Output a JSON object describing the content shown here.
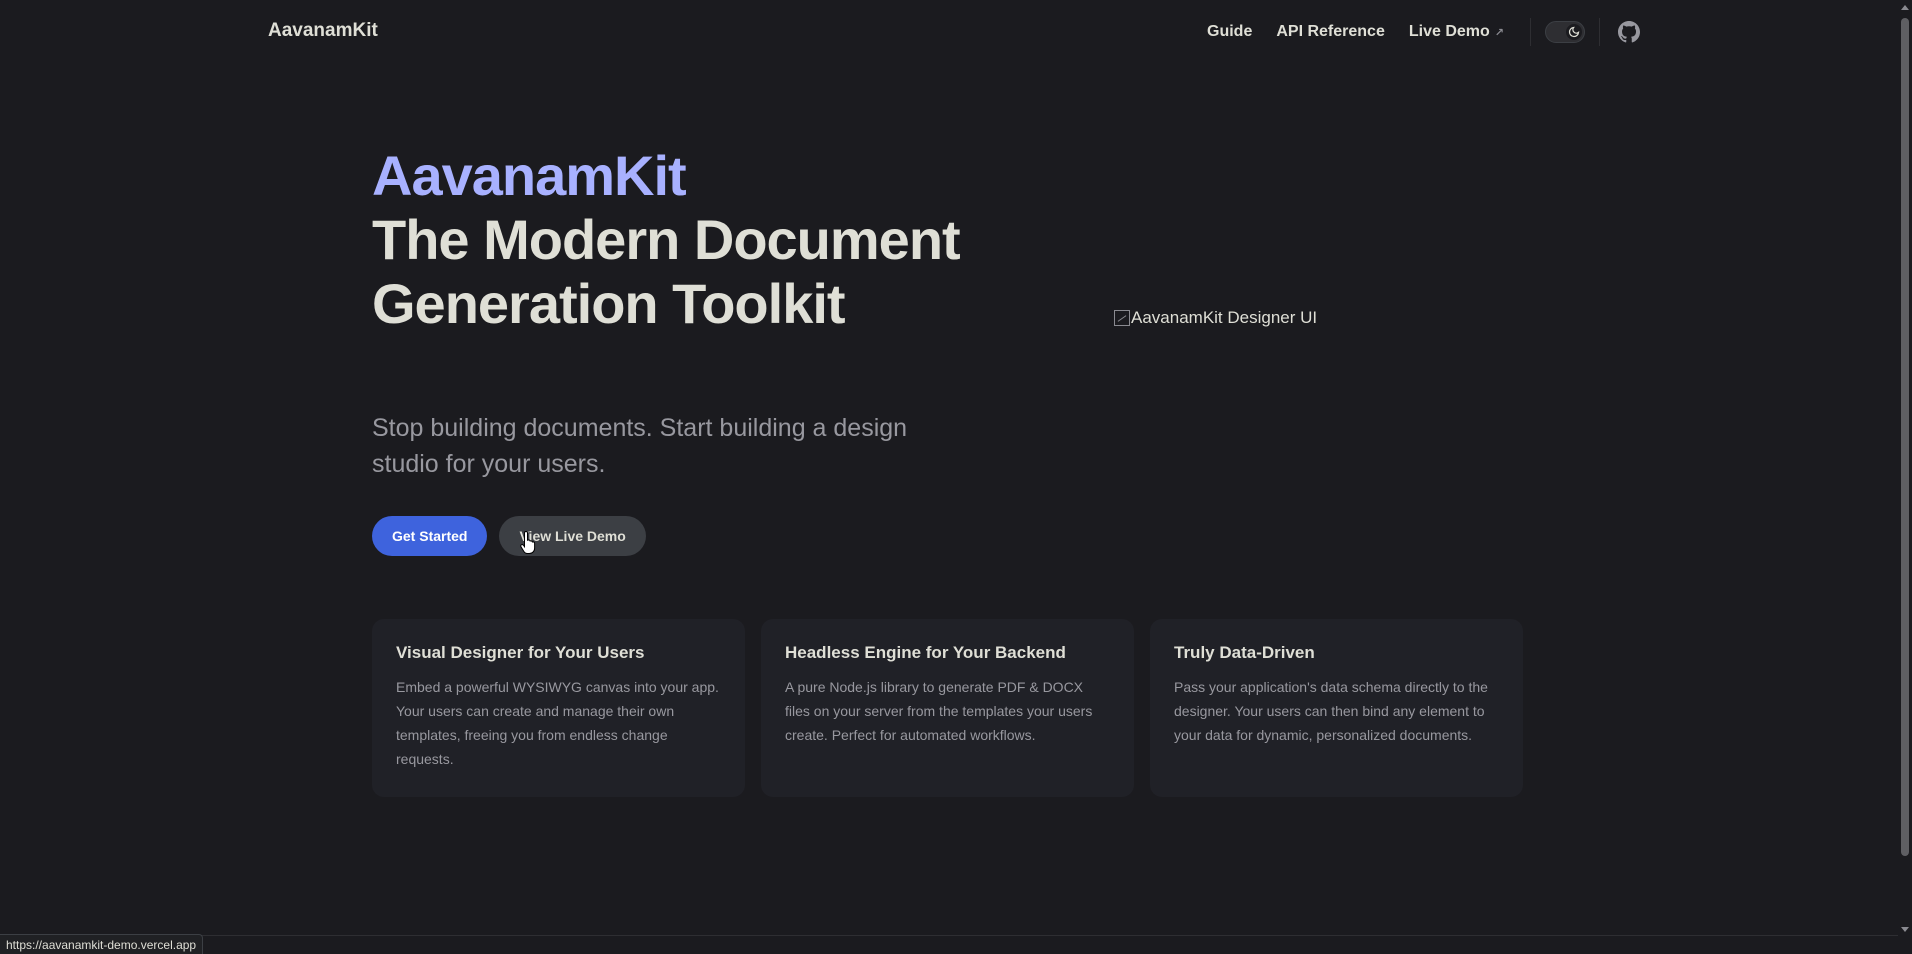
{
  "header": {
    "brand": "AavanamKit",
    "nav": [
      {
        "label": "Guide"
      },
      {
        "label": "API Reference"
      },
      {
        "label": "Live Demo"
      }
    ],
    "external_arrow": "↗",
    "theme_icon": "moon-icon",
    "github_icon": "github-icon"
  },
  "hero": {
    "name": "AavanamKit",
    "text": "The Modern Document Generation Toolkit",
    "tagline": "Stop building documents. Start building a design studio for your users.",
    "actions": {
      "primary": "Get Started",
      "secondary": "View Live Demo"
    },
    "image_alt": "AavanamKit Designer UI"
  },
  "features": [
    {
      "title": "Visual Designer for Your Users",
      "details": "Embed a powerful WYSIWYG canvas into your app. Your users can create and manage their own templates, freeing you from endless change requests."
    },
    {
      "title": "Headless Engine for Your Backend",
      "details": "A pure Node.js library to generate PDF & DOCX files on your server from the templates your users create. Perfect for automated workflows."
    },
    {
      "title": "Truly Data-Driven",
      "details": "Pass your application's data schema directly to the designer. Your users can then bind any element to your data for dynamic, personalized documents."
    }
  ],
  "status_bar": {
    "url": "https://aavanamkit-demo.vercel.app"
  },
  "colors": {
    "background": "#1b1b1f",
    "brand_accent": "#a8b1ff",
    "primary_button": "#3e63dd",
    "card_bg": "#202127"
  }
}
